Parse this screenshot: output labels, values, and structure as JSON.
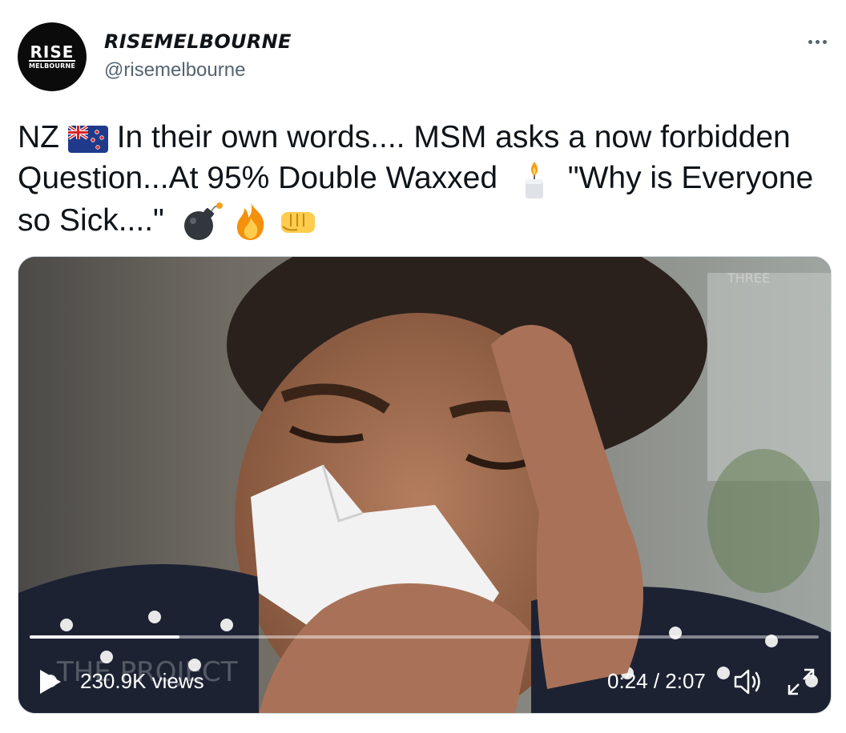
{
  "author": {
    "display_name": "RISEMELBOURNE",
    "handle": "@risemelbourne",
    "avatar_logo": {
      "line1": "RISE",
      "line2": "MELBOURNE"
    }
  },
  "menu": {
    "icon": "more-horizontal-icon"
  },
  "tweet": {
    "segments": [
      "NZ",
      "In their own words.... MSM asks a now forbidden Question...At 95% Double Waxxed",
      "\"Why is Everyone so Sick....\""
    ],
    "emojis": [
      "new-zealand-flag-emoji",
      "candle-emoji",
      "bomb-emoji",
      "fire-emoji",
      "oncoming-fist-emoji"
    ]
  },
  "video": {
    "views": "230.9K views",
    "time": "0:24 / 2:07",
    "progress": 0.19,
    "watermark_corner": "THREE",
    "watermark_bottom": "THE PROJECT"
  },
  "colors": {
    "text": "#0f1419",
    "secondary": "#536471",
    "border": "#cfd9de"
  }
}
